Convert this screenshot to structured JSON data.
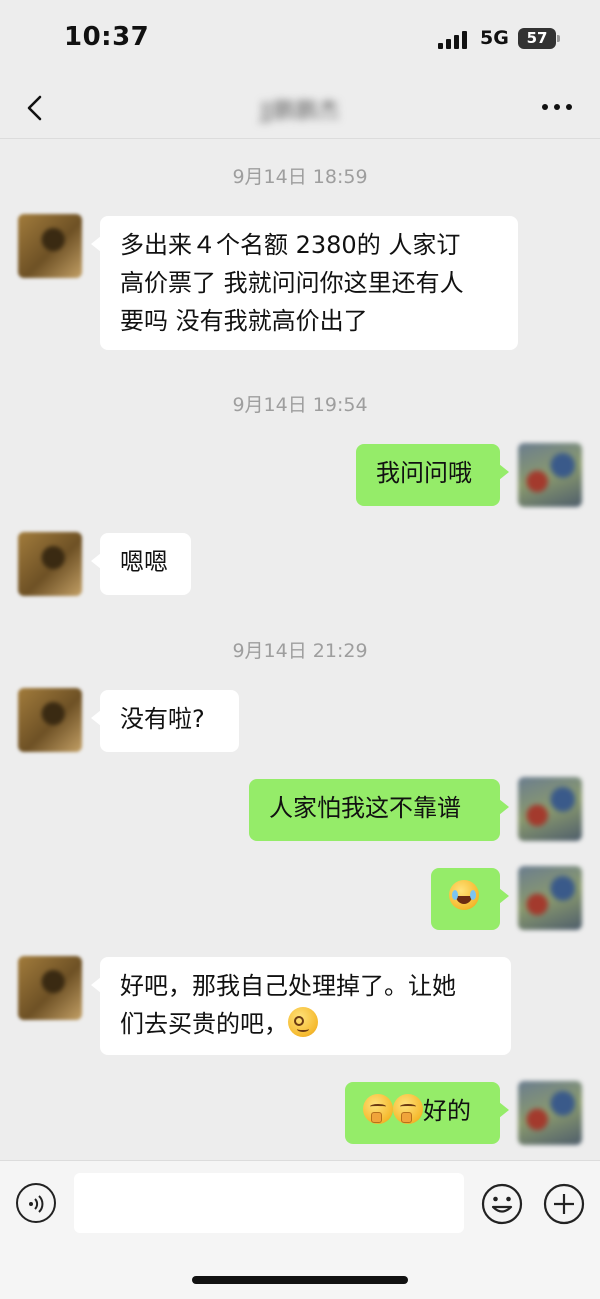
{
  "status_bar": {
    "time": "10:37",
    "network": "5G",
    "battery": "57"
  },
  "nav": {
    "title": "JJ鹏鹏杰"
  },
  "messages": [
    {
      "type": "timestamp",
      "text": "9月14日 18:59"
    },
    {
      "type": "text",
      "from": "friend",
      "lines": [
        "多出来４个名额 2380的  人家订",
        "高价票了 我就问问你这里还有人",
        "要吗 没有我就高价出了"
      ]
    },
    {
      "type": "timestamp",
      "text": "9月14日 19:54"
    },
    {
      "type": "text",
      "from": "me",
      "text": "我问问哦"
    },
    {
      "type": "text",
      "from": "friend",
      "text": "嗯嗯"
    },
    {
      "type": "timestamp",
      "text": "9月14日 21:29"
    },
    {
      "type": "text",
      "from": "friend",
      "text": "没有啦?"
    },
    {
      "type": "text",
      "from": "me",
      "text": "人家怕我这不靠谱"
    },
    {
      "type": "emoji",
      "from": "me",
      "emoji": "laugh-cry-emoji"
    },
    {
      "type": "text",
      "from": "friend",
      "lines": [
        "好吧，那我自己处理掉了。让她",
        "们去买贵的吧，"
      ],
      "emoji": "awkward-smile-emoji"
    },
    {
      "type": "text",
      "from": "me",
      "text": "好的",
      "emoji": "thinking-emoji"
    }
  ],
  "input_bar": {
    "placeholder": ""
  }
}
